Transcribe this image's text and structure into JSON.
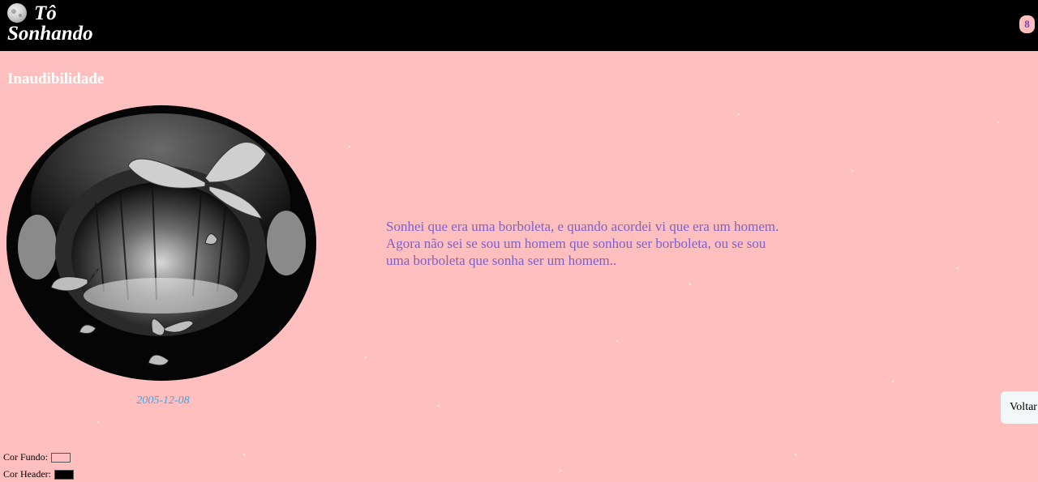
{
  "header": {
    "title_line1": "Tô",
    "title_line2": "Sonhando",
    "counter": "8",
    "logo_icon": "moon-icon",
    "background": "#000000"
  },
  "post": {
    "title": "Inaudibilidade",
    "date": "2005-12-08",
    "image_icon": "surreal-face-butterflies-image",
    "text_lines": [
      "Sonhei que era uma borboleta, e quando acordei vi que era um homem.",
      "Agora não sei se sou um homem que sonhou ser borboleta, ou se sou",
      "uma borboleta que sonha ser um homem.."
    ]
  },
  "nav": {
    "back_label": "Voltar"
  },
  "settings": {
    "bg_label": "Cor Fundo:",
    "bg_color": "#ffbfbf",
    "header_label": "Cor Header:",
    "header_color": "#000000"
  },
  "colors": {
    "page_bg": "#ffbfbf",
    "quote_text": "#7b62c8",
    "date_text": "#3fa6e6"
  }
}
